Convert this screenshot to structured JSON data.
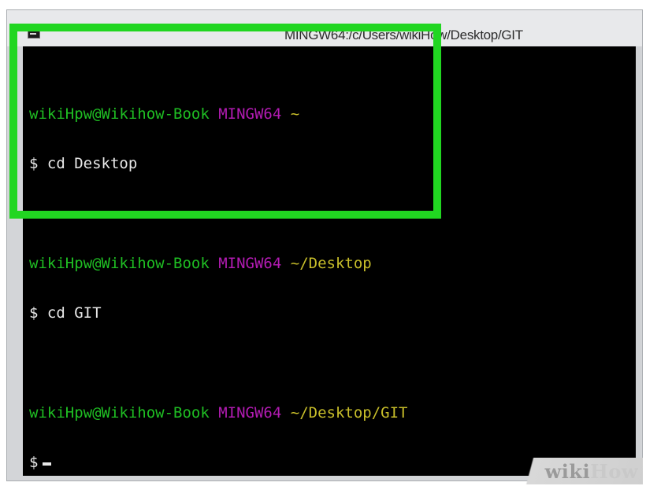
{
  "window": {
    "title": "MINGW64:/c/Users/wikiHow/Desktop/GIT"
  },
  "terminal": {
    "blocks": [
      {
        "user_host": "wikiHpw@Wikihow-Book",
        "env": "MINGW64",
        "path": "~",
        "command_prompt": "$",
        "command": "cd Desktop"
      },
      {
        "user_host": "wikiHpw@Wikihow-Book",
        "env": "MINGW64",
        "path": "~/Desktop",
        "command_prompt": "$",
        "command": "cd GIT"
      },
      {
        "user_host": "wikiHpw@Wikihow-Book",
        "env": "MINGW64",
        "path": "~/Desktop/GIT",
        "command_prompt": "$",
        "command": ""
      }
    ]
  },
  "watermark": {
    "part1": "wiki",
    "part2": "How"
  },
  "colors": {
    "highlight": "#21d621",
    "user_host": "#1fbe23",
    "env": "#b21bb2",
    "path": "#c8be2a",
    "terminal_bg": "#000000"
  },
  "icons": {
    "app_icon": "terminal-icon"
  }
}
